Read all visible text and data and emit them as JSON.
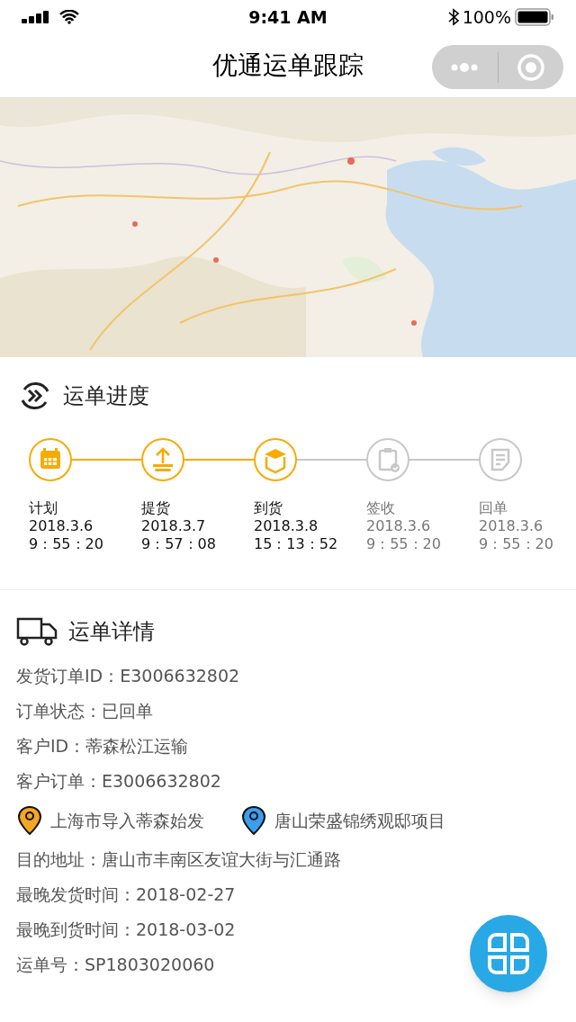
{
  "status_bar": {
    "time": "9:41 AM",
    "battery": "100%"
  },
  "nav": {
    "title": "优通运单跟踪"
  },
  "progress": {
    "title": "运单进度",
    "steps": [
      {
        "kind": "calendar",
        "label": "计划",
        "date": "2018.3.6",
        "time": "9：55：20",
        "done": true
      },
      {
        "kind": "upload",
        "label": "提货",
        "date": "2018.3.7",
        "time": "9：57：08",
        "done": true
      },
      {
        "kind": "box",
        "label": "到货",
        "date": "2018.3.8",
        "time": "15：13：52",
        "done": true
      },
      {
        "kind": "clipboard",
        "label": "签收",
        "date": "2018.3.6",
        "time": "9：55：20",
        "done": false
      },
      {
        "kind": "document",
        "label": "回单",
        "date": "2018.3.6",
        "time": "9：55：20",
        "done": false
      }
    ]
  },
  "details": {
    "title": "运单详情",
    "lines": [
      "发货订单ID：E3006632802",
      "订单状态：已回单",
      "客户ID：蒂森松江运输",
      "客户订单：E3006632802"
    ],
    "places": [
      {
        "name": "上海市导入蒂森始发",
        "color": "#f5a623"
      },
      {
        "name": "唐山荣盛锦绣观邸项目",
        "color": "#3b9ff0"
      }
    ],
    "more_lines": [
      "目的地址：唐山市丰南区友谊大街与汇通路",
      "最晚发货时间：2018-02-27",
      "最晚到货时间：2018-03-02",
      "运单号：SP1803020060"
    ]
  }
}
